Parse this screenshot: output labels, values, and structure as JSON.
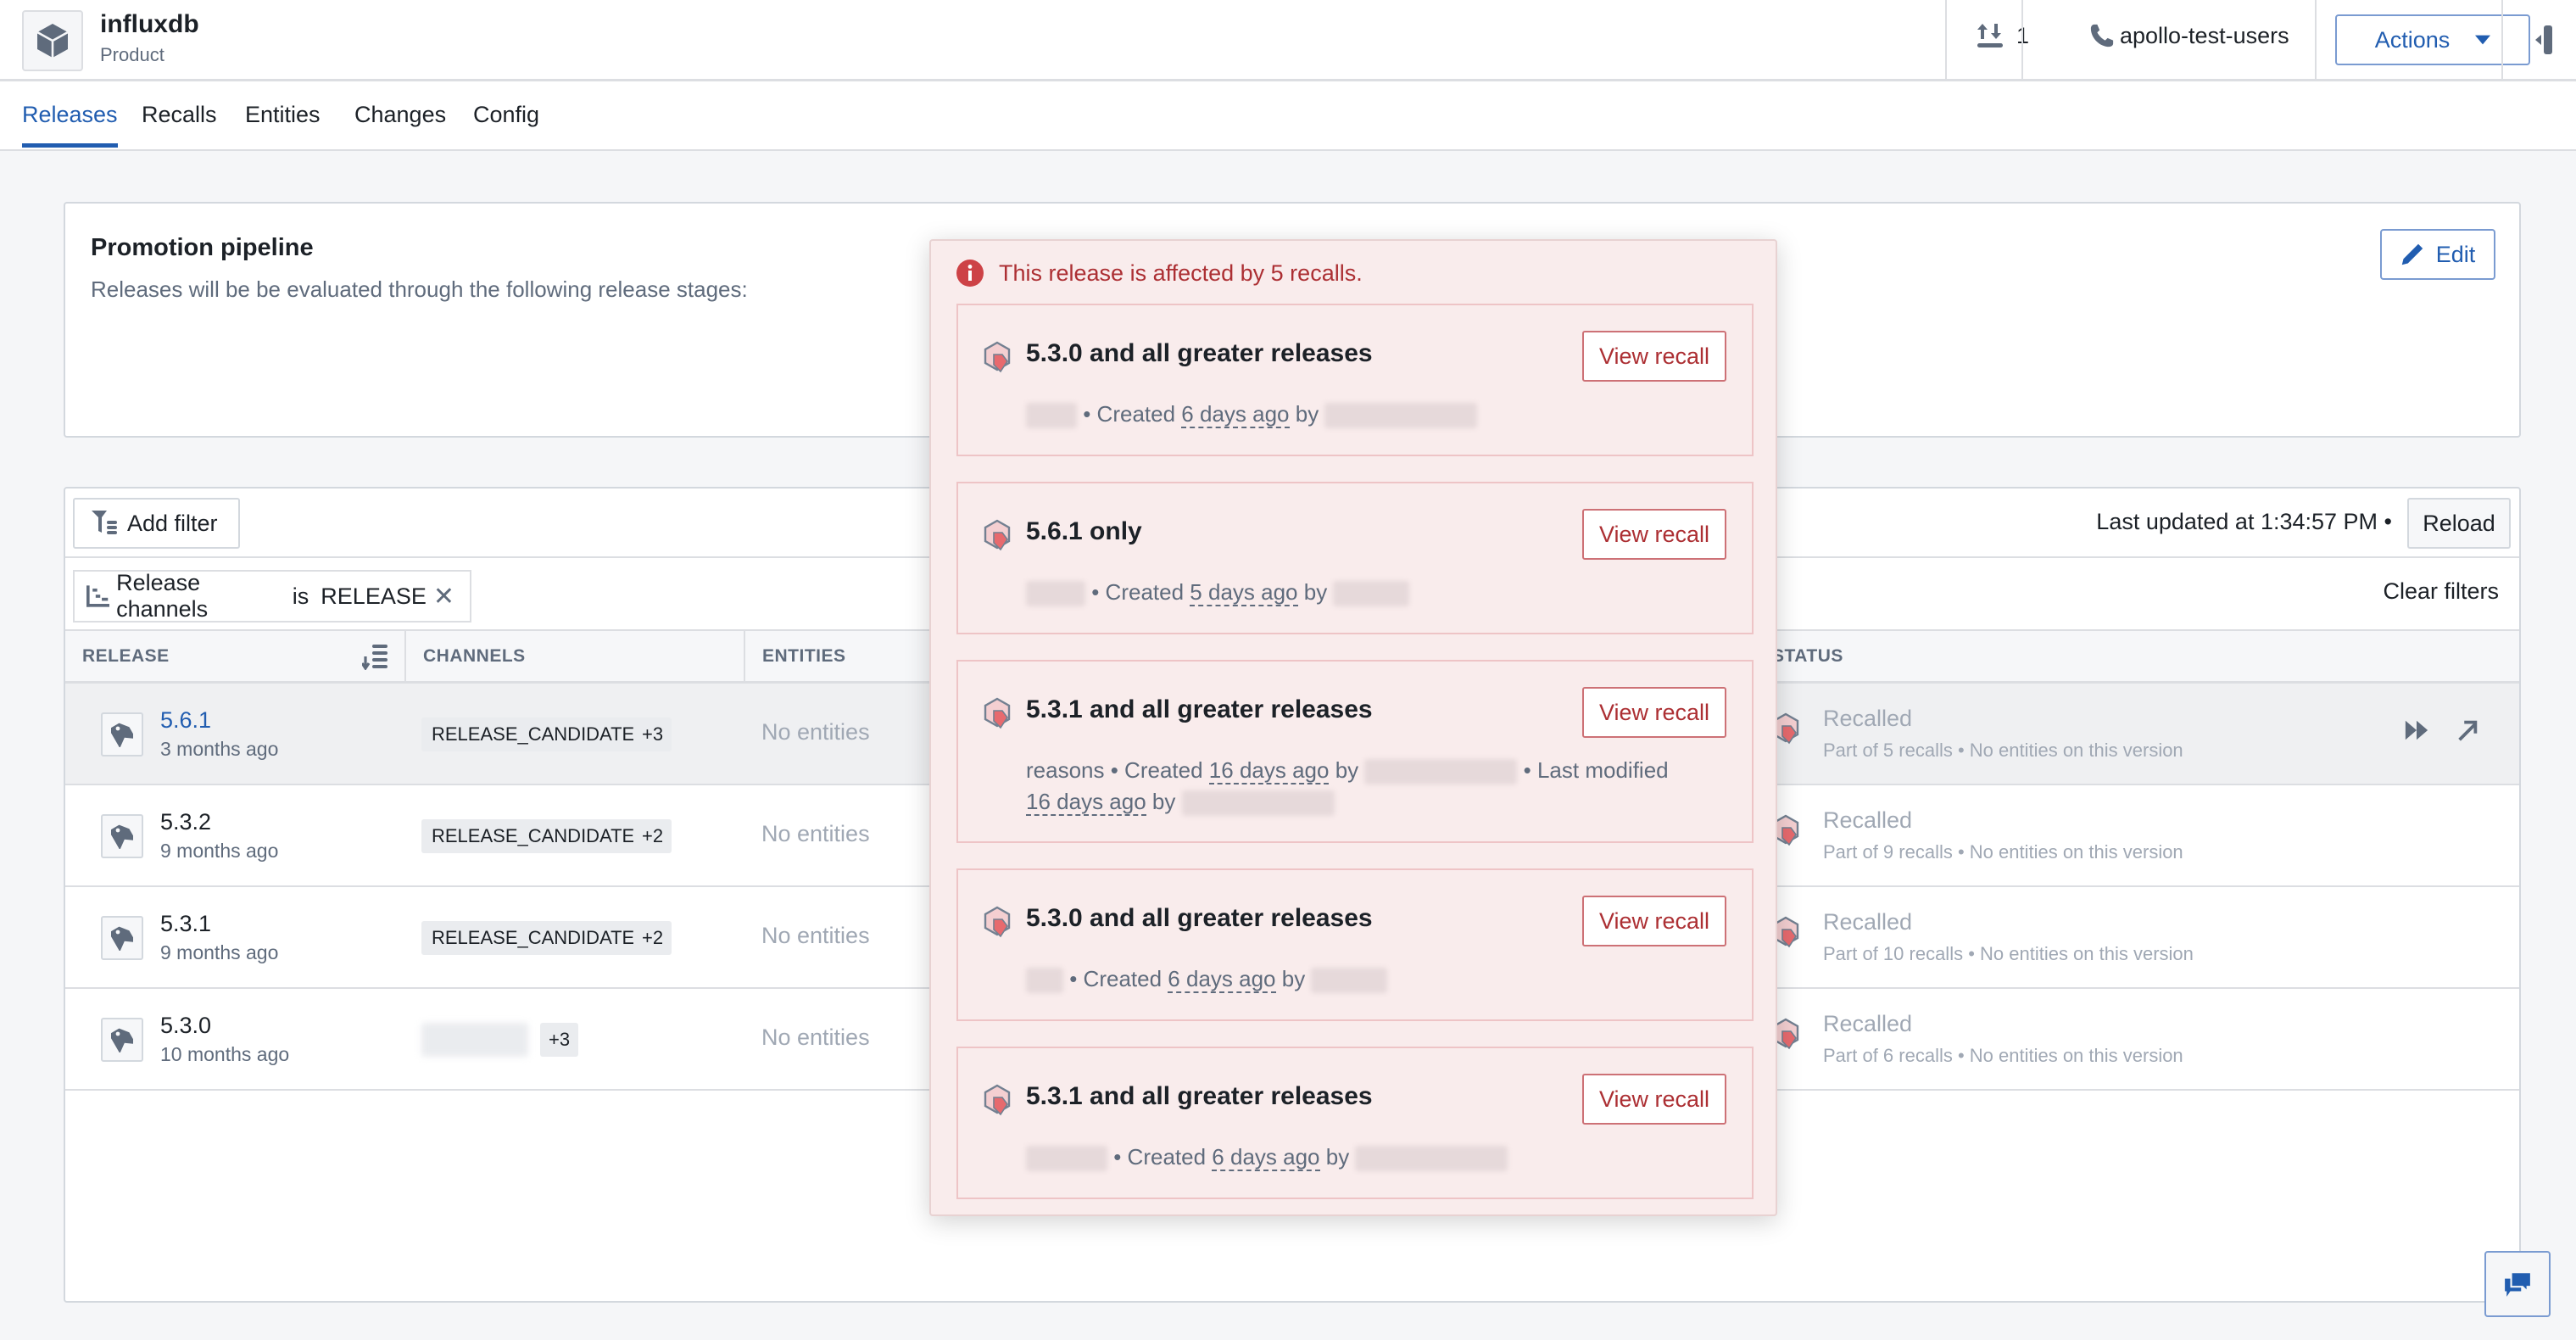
{
  "header": {
    "product_name": "influxdb",
    "product_type": "Product",
    "product_icon": "cube-icon",
    "upload_count": "1",
    "oncall_label": "apollo-test-users",
    "actions_label": "Actions"
  },
  "tabs": [
    {
      "label": "Releases",
      "active": true
    },
    {
      "label": "Recalls",
      "active": false
    },
    {
      "label": "Entities",
      "active": false
    },
    {
      "label": "Changes",
      "active": false
    },
    {
      "label": "Config",
      "active": false
    }
  ],
  "pipeline": {
    "title": "Promotion pipeline",
    "description": "Releases will be be evaluated through the following release stages:",
    "edit_label": "Edit"
  },
  "table": {
    "add_filter_label": "Add filter",
    "last_updated": "Last updated at 1:34:57 PM •",
    "reload_label": "Reload",
    "filter_chip": {
      "field": "Release channels",
      "op": "is",
      "value": "RELEASE"
    },
    "clear_filters_label": "Clear filters",
    "columns": [
      "RELEASE",
      "CHANNELS",
      "ENTITIES",
      "STATUS"
    ],
    "rows": [
      {
        "version": "5.6.1",
        "age": "3 months ago",
        "channel": "RELEASE_CANDIDATE",
        "more": "+3",
        "entities": "No entities",
        "status": "Recalled",
        "status_detail": "Part of 5 recalls • No entities on this version",
        "highlighted": true
      },
      {
        "version": "5.3.2",
        "age": "9 months ago",
        "channel": "RELEASE_CANDIDATE",
        "more": "+2",
        "entities": "No entities",
        "status": "Recalled",
        "status_detail": "Part of 9 recalls • No entities on this version",
        "highlighted": false
      },
      {
        "version": "5.3.1",
        "age": "9 months ago",
        "channel": "RELEASE_CANDIDATE",
        "more": "+2",
        "entities": "No entities",
        "status": "Recalled",
        "status_detail": "Part of 10 recalls • No entities on this version",
        "highlighted": false
      },
      {
        "version": "5.3.0",
        "age": "10 months ago",
        "channel": "",
        "more": "+3",
        "entities": "No entities",
        "status": "Recalled",
        "status_detail": "Part of 6 recalls • No entities on this version",
        "highlighted": false
      }
    ]
  },
  "popover": {
    "headline": "This release is affected by 5 recalls.",
    "view_label": "View recall",
    "recalls": [
      {
        "title": "5.3.0 and all greater releases",
        "prefix": "",
        "created_label": "• Created",
        "created": "6 days ago",
        "by": "by",
        "modified": null
      },
      {
        "title": "5.6.1 only",
        "prefix": "",
        "created_label": "• Created",
        "created": "5 days ago",
        "by": "by",
        "modified": null
      },
      {
        "title": "5.3.1 and all greater releases",
        "prefix": "reasons",
        "created_label": "• Created",
        "created": "16 days ago",
        "by": "by",
        "modified_label": "• Last modified",
        "modified": "16 days ago"
      },
      {
        "title": "5.3.0 and all greater releases",
        "prefix": "",
        "created_label": "• Created",
        "created": "6 days ago",
        "by": "by",
        "modified": null
      },
      {
        "title": "5.3.1 and all greater releases",
        "prefix": "",
        "created_label": "• Created",
        "created": "6 days ago",
        "by": "by",
        "modified": null
      }
    ]
  },
  "colors": {
    "accent": "#215db0",
    "danger": "#ac2f33",
    "popover_bg": "#f9ecec",
    "page_bg": "#f5f6f8"
  }
}
